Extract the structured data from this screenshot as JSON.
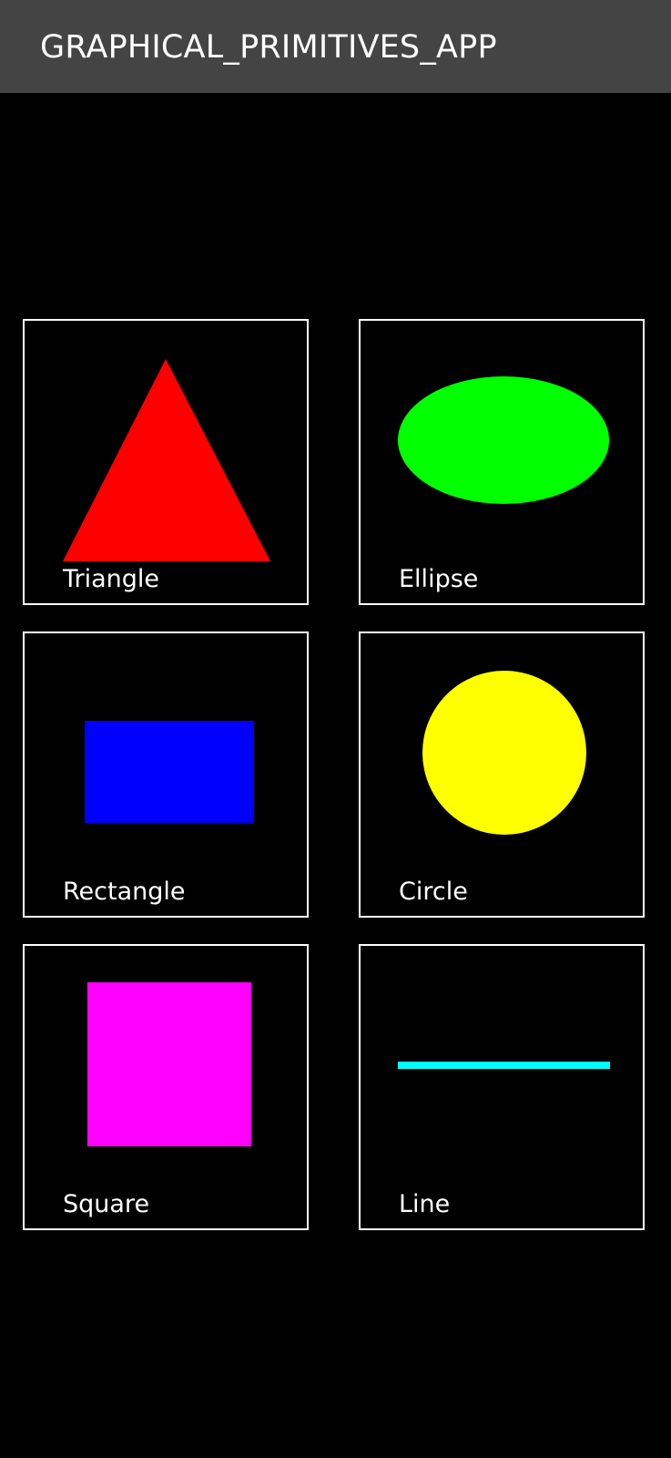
{
  "app_bar": {
    "title": "GRAPHICAL_PRIMITIVES_APP",
    "background": "#444444"
  },
  "shapes": [
    {
      "label": "Triangle",
      "shape": "triangle",
      "color": "#ff0000"
    },
    {
      "label": "Ellipse",
      "shape": "ellipse",
      "color": "#00ff00"
    },
    {
      "label": "Rectangle",
      "shape": "rectangle",
      "color": "#0000ff"
    },
    {
      "label": "Circle",
      "shape": "circle",
      "color": "#ffff00"
    },
    {
      "label": "Square",
      "shape": "square",
      "color": "#ff00ff"
    },
    {
      "label": "Line",
      "shape": "line",
      "color": "#00ffff"
    }
  ]
}
